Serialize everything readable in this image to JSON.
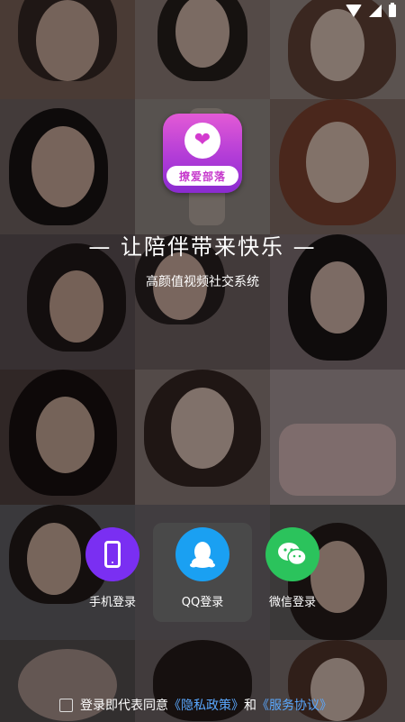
{
  "status_bar": {
    "icons": [
      "wifi-icon",
      "signal-icon",
      "battery-icon"
    ]
  },
  "logo": {
    "text": "撩爱部落",
    "icon": "heart-hand-icon"
  },
  "slogan": "— 让陪伴带来快乐 —",
  "subtitle": "高颜值视频社交系统",
  "login_options": [
    {
      "label": "手机登录",
      "icon": "phone-icon",
      "color": "#7a2ff2"
    },
    {
      "label": "QQ登录",
      "icon": "qq-penguin-icon",
      "color": "#1aa0f2"
    },
    {
      "label": "微信登录",
      "icon": "wechat-icon",
      "color": "#2bc35c"
    }
  ],
  "agreement": {
    "prefix": "登录即代表同意",
    "privacy_link": "《隐私政策》",
    "and": "和",
    "service_link": "《服务协议》"
  },
  "colors": {
    "accent_link": "#5aa8ff",
    "logo_gradient_top": "#e35ad6",
    "logo_gradient_bottom": "#8a2bd0"
  }
}
